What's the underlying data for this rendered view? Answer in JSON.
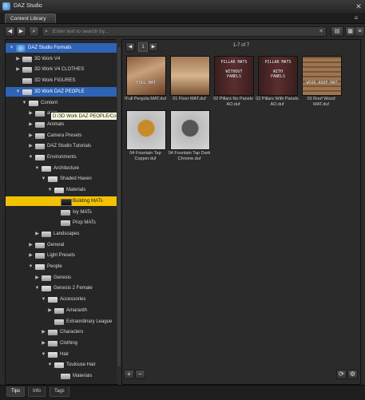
{
  "app": {
    "title": "DAZ Studio"
  },
  "tabs": {
    "active": "Content Library"
  },
  "search": {
    "placeholder": "Enter text to search by..."
  },
  "tooltip": "D:/3D Work DAZ PEOPLE/Content",
  "tree": [
    {
      "label": "DAZ Studio Formats",
      "depth": 0,
      "arrow": "down",
      "kind": "root",
      "state": "selected"
    },
    {
      "label": "3D Work V4",
      "depth": 1,
      "arrow": "right",
      "kind": "folder",
      "state": ""
    },
    {
      "label": "3D Work V4 CLOTHES",
      "depth": 1,
      "arrow": "right",
      "kind": "folder",
      "state": ""
    },
    {
      "label": "3D Work FIGURES",
      "depth": 1,
      "arrow": "",
      "kind": "folder",
      "state": ""
    },
    {
      "label": "3D Work DAZ PEOPLE",
      "depth": 1,
      "arrow": "down",
      "kind": "folder-open",
      "state": "selected"
    },
    {
      "label": "Content",
      "depth": 2,
      "arrow": "down",
      "kind": "folder-open",
      "state": ""
    },
    {
      "label": "anim...",
      "depth": 3,
      "arrow": "right",
      "kind": "folder",
      "state": ""
    },
    {
      "label": "Animals",
      "depth": 3,
      "arrow": "right",
      "kind": "folder",
      "state": ""
    },
    {
      "label": "Camera Presets",
      "depth": 3,
      "arrow": "right",
      "kind": "folder",
      "state": ""
    },
    {
      "label": "DAZ Studio Tutorials",
      "depth": 3,
      "arrow": "right",
      "kind": "folder",
      "state": ""
    },
    {
      "label": "Environments",
      "depth": 3,
      "arrow": "down",
      "kind": "folder-open",
      "state": ""
    },
    {
      "label": "Architecture",
      "depth": 4,
      "arrow": "down",
      "kind": "folder-open",
      "state": ""
    },
    {
      "label": "Shaded Haven",
      "depth": 5,
      "arrow": "down",
      "kind": "folder-open",
      "state": ""
    },
    {
      "label": "Materials",
      "depth": 6,
      "arrow": "down",
      "kind": "folder-open",
      "state": ""
    },
    {
      "label": "Building MATs",
      "depth": 7,
      "arrow": "",
      "kind": "folder-dark",
      "state": "highlight"
    },
    {
      "label": "Ivy MATs",
      "depth": 7,
      "arrow": "",
      "kind": "folder",
      "state": ""
    },
    {
      "label": "Prop MATs",
      "depth": 7,
      "arrow": "",
      "kind": "folder",
      "state": ""
    },
    {
      "label": "Landscapes",
      "depth": 4,
      "arrow": "right",
      "kind": "folder",
      "state": ""
    },
    {
      "label": "General",
      "depth": 3,
      "arrow": "right",
      "kind": "folder",
      "state": ""
    },
    {
      "label": "Light Presets",
      "depth": 3,
      "arrow": "right",
      "kind": "folder",
      "state": ""
    },
    {
      "label": "People",
      "depth": 3,
      "arrow": "down",
      "kind": "folder-open",
      "state": ""
    },
    {
      "label": "Genesis",
      "depth": 4,
      "arrow": "right",
      "kind": "folder",
      "state": ""
    },
    {
      "label": "Genesis 2 Female",
      "depth": 4,
      "arrow": "down",
      "kind": "folder-open",
      "state": ""
    },
    {
      "label": "Accessories",
      "depth": 5,
      "arrow": "down",
      "kind": "folder-open",
      "state": ""
    },
    {
      "label": "Amaranth",
      "depth": 6,
      "arrow": "right",
      "kind": "folder",
      "state": ""
    },
    {
      "label": "Extraordinary League",
      "depth": 6,
      "arrow": "",
      "kind": "folder",
      "state": ""
    },
    {
      "label": "Characters",
      "depth": 5,
      "arrow": "right",
      "kind": "folder",
      "state": ""
    },
    {
      "label": "Clothing",
      "depth": 5,
      "arrow": "right",
      "kind": "folder",
      "state": ""
    },
    {
      "label": "Hair",
      "depth": 5,
      "arrow": "down",
      "kind": "folder-open",
      "state": ""
    },
    {
      "label": "Toulouse Hair",
      "depth": 6,
      "arrow": "down",
      "kind": "folder-open",
      "state": ""
    },
    {
      "label": "Materials",
      "depth": 7,
      "arrow": "",
      "kind": "folder",
      "state": ""
    }
  ],
  "pager": {
    "page": "1",
    "count": "1-7 of 7"
  },
  "items": [
    {
      "overlay": "FULL MAT",
      "caption": "!Full Pergola MAT.duf",
      "style": "wood"
    },
    {
      "overlay": "",
      "caption": "01 Floor MAT.duf",
      "style": "floor"
    },
    {
      "overlay": "PILLAR MATS\n\nWITHOUT\nPANELS",
      "caption": "02 Pillars No Panels AO.duf",
      "style": "pillar"
    },
    {
      "overlay": "PILLAR MATS\n\nWITH\nPANELS",
      "caption": "02 Pillars With Panels AO.duf",
      "style": "pillar"
    },
    {
      "overlay": "WOOD ROOF MAT",
      "caption": "03 Roof Wood MAT.duf",
      "style": "roof"
    },
    {
      "overlay": "",
      "caption": "04 Fountain Tap Copper.duf",
      "style": "tap-copper"
    },
    {
      "overlay": "",
      "caption": "04 Fountain Tap Dark Chrome.duf",
      "style": "tap-chrome"
    }
  ],
  "bottom_tabs": [
    "Tips",
    "Info",
    "Tags"
  ],
  "colors": {
    "selection": "#2f63b6",
    "highlight": "#f2c200"
  }
}
